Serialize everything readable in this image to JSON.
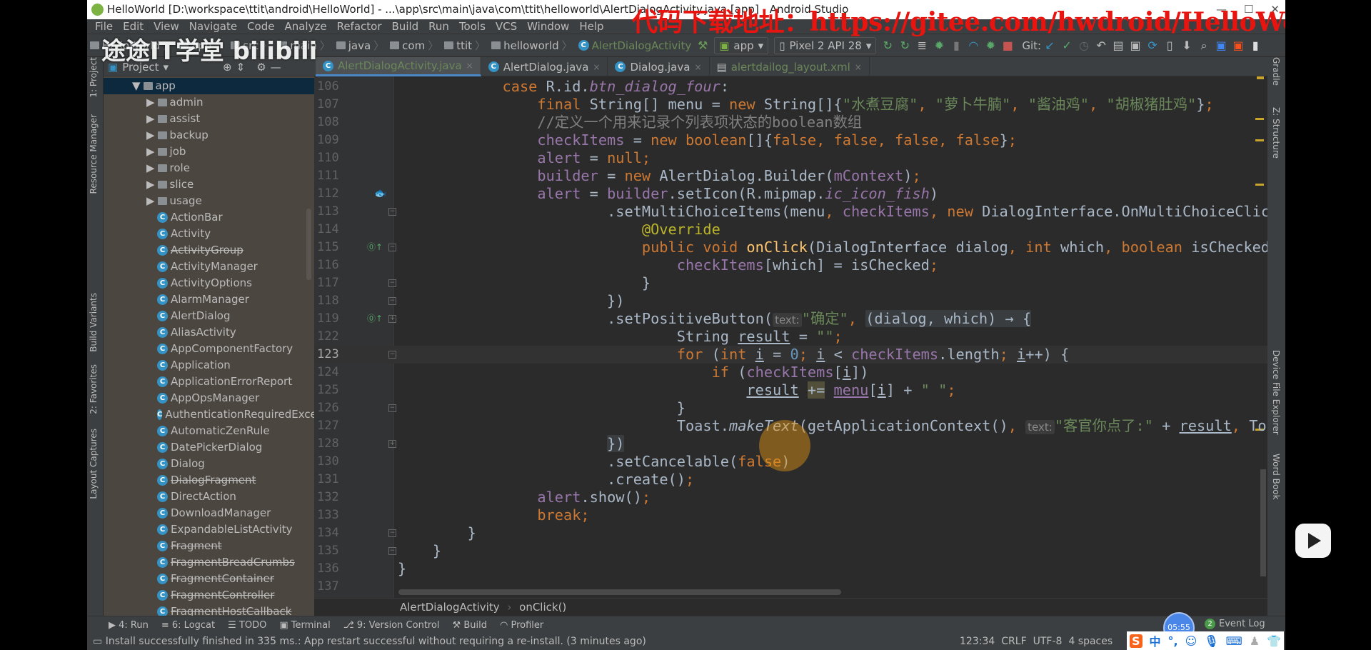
{
  "window": {
    "title": "HelloWorld [D:\\workspace\\ttit\\android\\HelloWorld] - ...\\app\\src\\main\\java\\com\\ttit\\helloworld\\AlertDialogActivity.java [app] - Android Studio",
    "min": "—",
    "max": "☐",
    "close": "✕"
  },
  "watermark": {
    "text": "代码下载地址：https://gitee.com/hwdroid/HelloWorld",
    "channel": "途途IT学堂 bilibili"
  },
  "menu": [
    "File",
    "Edit",
    "View",
    "Navigate",
    "Code",
    "Analyze",
    "Refactor",
    "Build",
    "Run",
    "Tools",
    "VCS",
    "Window",
    "Help"
  ],
  "nav": {
    "crumbs": [
      "HelloWorld",
      "app",
      "src",
      "main",
      "java",
      "com",
      "ttit",
      "helloworld",
      "AlertDialogActivity"
    ],
    "run_config": "app",
    "device": "Pixel 2 API 28",
    "git_label": "Git:"
  },
  "toolbar_icons": [
    "hammer-icon",
    "apply-changes-icon",
    "apply-code-changes-icon",
    "run-icon",
    "debug-icon",
    "profile-icon",
    "attach-debugger-icon",
    "stop-icon",
    "git-update-icon",
    "git-commit-icon",
    "git-history-icon",
    "git-rollback-icon",
    "project-structure-icon",
    "sdk-manager-icon",
    "avd-manager-icon",
    "sync-icon",
    "search-icon",
    "translate-icon"
  ],
  "project_panel": {
    "title": "Project",
    "tree": [
      {
        "label": "app",
        "kind": "module",
        "expanded": true,
        "selected": true
      },
      {
        "label": "admin",
        "kind": "package"
      },
      {
        "label": "assist",
        "kind": "package"
      },
      {
        "label": "backup",
        "kind": "package"
      },
      {
        "label": "job",
        "kind": "package"
      },
      {
        "label": "role",
        "kind": "package"
      },
      {
        "label": "slice",
        "kind": "package"
      },
      {
        "label": "usage",
        "kind": "package"
      },
      {
        "label": "ActionBar",
        "kind": "class"
      },
      {
        "label": "Activity",
        "kind": "class"
      },
      {
        "label": "ActivityGroup",
        "kind": "class",
        "deprecated": true
      },
      {
        "label": "ActivityManager",
        "kind": "class"
      },
      {
        "label": "ActivityOptions",
        "kind": "class"
      },
      {
        "label": "AlarmManager",
        "kind": "class"
      },
      {
        "label": "AlertDialog",
        "kind": "class"
      },
      {
        "label": "AliasActivity",
        "kind": "class"
      },
      {
        "label": "AppComponentFactory",
        "kind": "class"
      },
      {
        "label": "Application",
        "kind": "class"
      },
      {
        "label": "ApplicationErrorReport",
        "kind": "class"
      },
      {
        "label": "AppOpsManager",
        "kind": "class"
      },
      {
        "label": "AuthenticationRequiredException",
        "kind": "class"
      },
      {
        "label": "AutomaticZenRule",
        "kind": "class"
      },
      {
        "label": "DatePickerDialog",
        "kind": "class"
      },
      {
        "label": "Dialog",
        "kind": "class"
      },
      {
        "label": "DialogFragment",
        "kind": "class",
        "deprecated": true
      },
      {
        "label": "DirectAction",
        "kind": "class"
      },
      {
        "label": "DownloadManager",
        "kind": "class"
      },
      {
        "label": "ExpandableListActivity",
        "kind": "class"
      },
      {
        "label": "Fragment",
        "kind": "class",
        "deprecated": true
      },
      {
        "label": "FragmentBreadCrumbs",
        "kind": "class",
        "deprecated": true
      },
      {
        "label": "FragmentContainer",
        "kind": "class",
        "deprecated": true
      },
      {
        "label": "FragmentController",
        "kind": "class",
        "deprecated": true
      },
      {
        "label": "FragmentHostCallback",
        "kind": "class",
        "deprecated": true
      }
    ]
  },
  "left_strip": [
    "1: Project",
    "Resource Manager",
    "Build Variants",
    "2: Favorites",
    "Layout Captures"
  ],
  "right_strip": [
    "Gradle",
    "Z: Structure",
    "Device File Explorer",
    "Word Book"
  ],
  "tabs": [
    {
      "label": "AlertDialogActivity.java",
      "active": true
    },
    {
      "label": "AlertDialog.java"
    },
    {
      "label": "Dialog.java"
    },
    {
      "label": "alertdailog_layout.xml"
    }
  ],
  "editor": {
    "current_line": "123",
    "lines": [
      {
        "n": "106",
        "t": [
          [
            "            ",
            ""
          ],
          [
            "case ",
            "k"
          ],
          [
            "R.id.",
            ""
          ],
          [
            "btn_dialog_four",
            "fi"
          ],
          [
            ":",
            ""
          ]
        ]
      },
      {
        "n": "107",
        "t": [
          [
            "                ",
            ""
          ],
          [
            "final ",
            "k"
          ],
          [
            "String[] menu = ",
            ""
          ],
          [
            "new ",
            "k"
          ],
          [
            "String[]{",
            ""
          ],
          [
            "\"水煮豆腐\"",
            "s"
          ],
          [
            ", ",
            "k"
          ],
          [
            "\"萝卜牛腩\"",
            "s"
          ],
          [
            ", ",
            "k"
          ],
          [
            "\"酱油鸡\"",
            "s"
          ],
          [
            ", ",
            "k"
          ],
          [
            "\"胡椒猪肚鸡\"",
            "s"
          ],
          [
            "}",
            ""
          ],
          [
            ";",
            "k"
          ]
        ]
      },
      {
        "n": "108",
        "t": [
          [
            "                ",
            ""
          ],
          [
            "//定义一个用来记录个列表项状态的boolean数组",
            "c"
          ]
        ]
      },
      {
        "n": "109",
        "t": [
          [
            "                ",
            ""
          ],
          [
            "checkItems",
            "f"
          ],
          [
            " = ",
            ""
          ],
          [
            "new boolean",
            "k"
          ],
          [
            "[]{",
            ""
          ],
          [
            "false, false, false, false",
            "k"
          ],
          [
            "}",
            ""
          ],
          [
            ";",
            "k"
          ]
        ]
      },
      {
        "n": "110",
        "t": [
          [
            "                ",
            ""
          ],
          [
            "alert",
            "f"
          ],
          [
            " = ",
            ""
          ],
          [
            "null;",
            "k"
          ]
        ]
      },
      {
        "n": "111",
        "t": [
          [
            "                ",
            ""
          ],
          [
            "builder",
            "f"
          ],
          [
            " = ",
            ""
          ],
          [
            "new ",
            "k"
          ],
          [
            "AlertDialog.Builder(",
            ""
          ],
          [
            "mContext",
            "f"
          ],
          [
            ")",
            ""
          ],
          [
            ";",
            "k"
          ]
        ]
      },
      {
        "n": "112",
        "t": [
          [
            "                ",
            ""
          ],
          [
            "alert",
            "f"
          ],
          [
            " = ",
            ""
          ],
          [
            "builder",
            "f"
          ],
          [
            ".setIcon(R.mipmap.",
            ""
          ],
          [
            "ic_icon_fish",
            "fi"
          ],
          [
            ")",
            ""
          ]
        ]
      },
      {
        "n": "113",
        "t": [
          [
            "                        ",
            ""
          ],
          [
            ".setMultiChoiceItems(menu",
            ""
          ],
          [
            ", ",
            "k"
          ],
          [
            "checkItems",
            "f"
          ],
          [
            ", ",
            "k"
          ],
          [
            "new ",
            "k"
          ],
          [
            "DialogInterface.OnMultiChoiceClickListener() {",
            ""
          ]
        ]
      },
      {
        "n": "114",
        "t": [
          [
            "                            ",
            ""
          ],
          [
            "@Override",
            "a"
          ]
        ]
      },
      {
        "n": "115",
        "t": [
          [
            "                            ",
            ""
          ],
          [
            "public void ",
            "k"
          ],
          [
            "onClick",
            "m"
          ],
          [
            "(DialogInterface dialog",
            ""
          ],
          [
            ", ",
            "k"
          ],
          [
            "int ",
            "k"
          ],
          [
            "which",
            ""
          ],
          [
            ", ",
            "k"
          ],
          [
            "boolean ",
            "k"
          ],
          [
            "isChecked) {",
            ""
          ]
        ]
      },
      {
        "n": "116",
        "t": [
          [
            "                                ",
            ""
          ],
          [
            "checkItems",
            "f"
          ],
          [
            "[which] = isChecked",
            ""
          ],
          [
            ";",
            "k"
          ]
        ]
      },
      {
        "n": "117",
        "t": [
          [
            "                            }",
            ""
          ]
        ]
      },
      {
        "n": "118",
        "t": [
          [
            "                        })",
            ""
          ]
        ]
      },
      {
        "n": "119",
        "t": [
          [
            "                        ",
            ""
          ],
          [
            ".setPositiveButton(",
            ""
          ],
          [
            "text:",
            "hint"
          ],
          [
            "\"确定\"",
            "s"
          ],
          [
            ", ",
            "k"
          ],
          [
            "(dialog, which) → {",
            "folded"
          ]
        ]
      },
      {
        "n": "122",
        "t": [
          [
            "                                ",
            ""
          ],
          [
            "String ",
            ""
          ],
          [
            "result",
            "u"
          ],
          [
            " = ",
            ""
          ],
          [
            "\"\"",
            "s"
          ],
          [
            ";",
            "k"
          ]
        ]
      },
      {
        "n": "123",
        "t": [
          [
            "                                ",
            ""
          ],
          [
            "for ",
            "k"
          ],
          [
            "(",
            ""
          ],
          [
            "int ",
            "k"
          ],
          [
            "i",
            "u"
          ],
          [
            " = ",
            ""
          ],
          [
            "0",
            "n"
          ],
          [
            "; ",
            "k"
          ],
          [
            "i",
            "u"
          ],
          [
            " < ",
            ""
          ],
          [
            "checkItems",
            "f"
          ],
          [
            ".length",
            ""
          ],
          [
            "; ",
            "k"
          ],
          [
            "i",
            "u"
          ],
          [
            "++) {",
            ""
          ]
        ]
      },
      {
        "n": "124",
        "t": [
          [
            "                                    ",
            ""
          ],
          [
            "if ",
            "k"
          ],
          [
            "(",
            ""
          ],
          [
            "checkItems",
            "f"
          ],
          [
            "[",
            ""
          ],
          [
            "i",
            "u"
          ],
          [
            "])",
            ""
          ]
        ]
      },
      {
        "n": "125",
        "t": [
          [
            "                                        ",
            ""
          ],
          [
            "result",
            "u"
          ],
          [
            " ",
            ""
          ],
          [
            "+=",
            "hl"
          ],
          [
            " ",
            ""
          ],
          [
            "menu",
            "f u"
          ],
          [
            "[",
            ""
          ],
          [
            "i",
            "u"
          ],
          [
            "] + ",
            ""
          ],
          [
            "\" \"",
            "s"
          ],
          [
            ";",
            "k"
          ]
        ]
      },
      {
        "n": "126",
        "t": [
          [
            "                                }",
            ""
          ]
        ]
      },
      {
        "n": "127",
        "t": [
          [
            "                                ",
            ""
          ],
          [
            "Toast.",
            ""
          ],
          [
            "makeText",
            "i"
          ],
          [
            "(getApplicationContext()",
            ""
          ],
          [
            ", ",
            "k"
          ],
          [
            "text:",
            "hint"
          ],
          [
            "\"客官你点了:\"",
            "s"
          ],
          [
            " + ",
            ""
          ],
          [
            "result",
            "u"
          ],
          [
            ", ",
            "k"
          ],
          [
            "Toast.",
            ""
          ],
          [
            "LENGTH_SHORT",
            "fi"
          ],
          [
            ").show()",
            ""
          ],
          [
            ";",
            "k"
          ]
        ]
      },
      {
        "n": "128",
        "t": [
          [
            "                        ",
            ""
          ],
          [
            "})",
            "folded"
          ]
        ]
      },
      {
        "n": "130",
        "t": [
          [
            "                        ",
            ""
          ],
          [
            ".setCancelable(",
            ""
          ],
          [
            "false",
            "k"
          ],
          [
            ")",
            ""
          ]
        ]
      },
      {
        "n": "131",
        "t": [
          [
            "                        ",
            ""
          ],
          [
            ".create()",
            ""
          ],
          [
            ";",
            "k"
          ]
        ]
      },
      {
        "n": "132",
        "t": [
          [
            "                ",
            ""
          ],
          [
            "alert",
            "f"
          ],
          [
            ".show()",
            ""
          ],
          [
            ";",
            "k"
          ]
        ]
      },
      {
        "n": "133",
        "t": [
          [
            "                ",
            ""
          ],
          [
            "break;",
            "k"
          ]
        ]
      },
      {
        "n": "134",
        "t": [
          [
            "        }",
            ""
          ]
        ]
      },
      {
        "n": "135",
        "t": [
          [
            "    }",
            ""
          ]
        ]
      },
      {
        "n": "136",
        "t": [
          [
            "}",
            ""
          ]
        ]
      },
      {
        "n": "137",
        "t": []
      }
    ]
  },
  "breadcrumb": {
    "class": "AlertDialogActivity",
    "method": "onClick()"
  },
  "tool_windows": [
    "4: Run",
    "6: Logcat",
    "TODO",
    "Terminal",
    "9: Version Control",
    "Build",
    "Profiler"
  ],
  "event_log": {
    "label": "Event Log",
    "count": "2"
  },
  "timer": "05:55",
  "status": {
    "message": "Install successfully finished in 335 ms.: App restart successful without requiring a re-install. (3 minutes ago)",
    "position": "123:34",
    "line_sep": "CRLF",
    "encoding": "UTF-8",
    "indent": "4 spaces"
  },
  "ime": {
    "logo": "S",
    "lang": "中",
    "punct": "°,",
    "icons": [
      "emoji-icon",
      "mic-icon",
      "keyboard-icon",
      "user-icon",
      "skin-icon",
      "grid-icon"
    ]
  }
}
